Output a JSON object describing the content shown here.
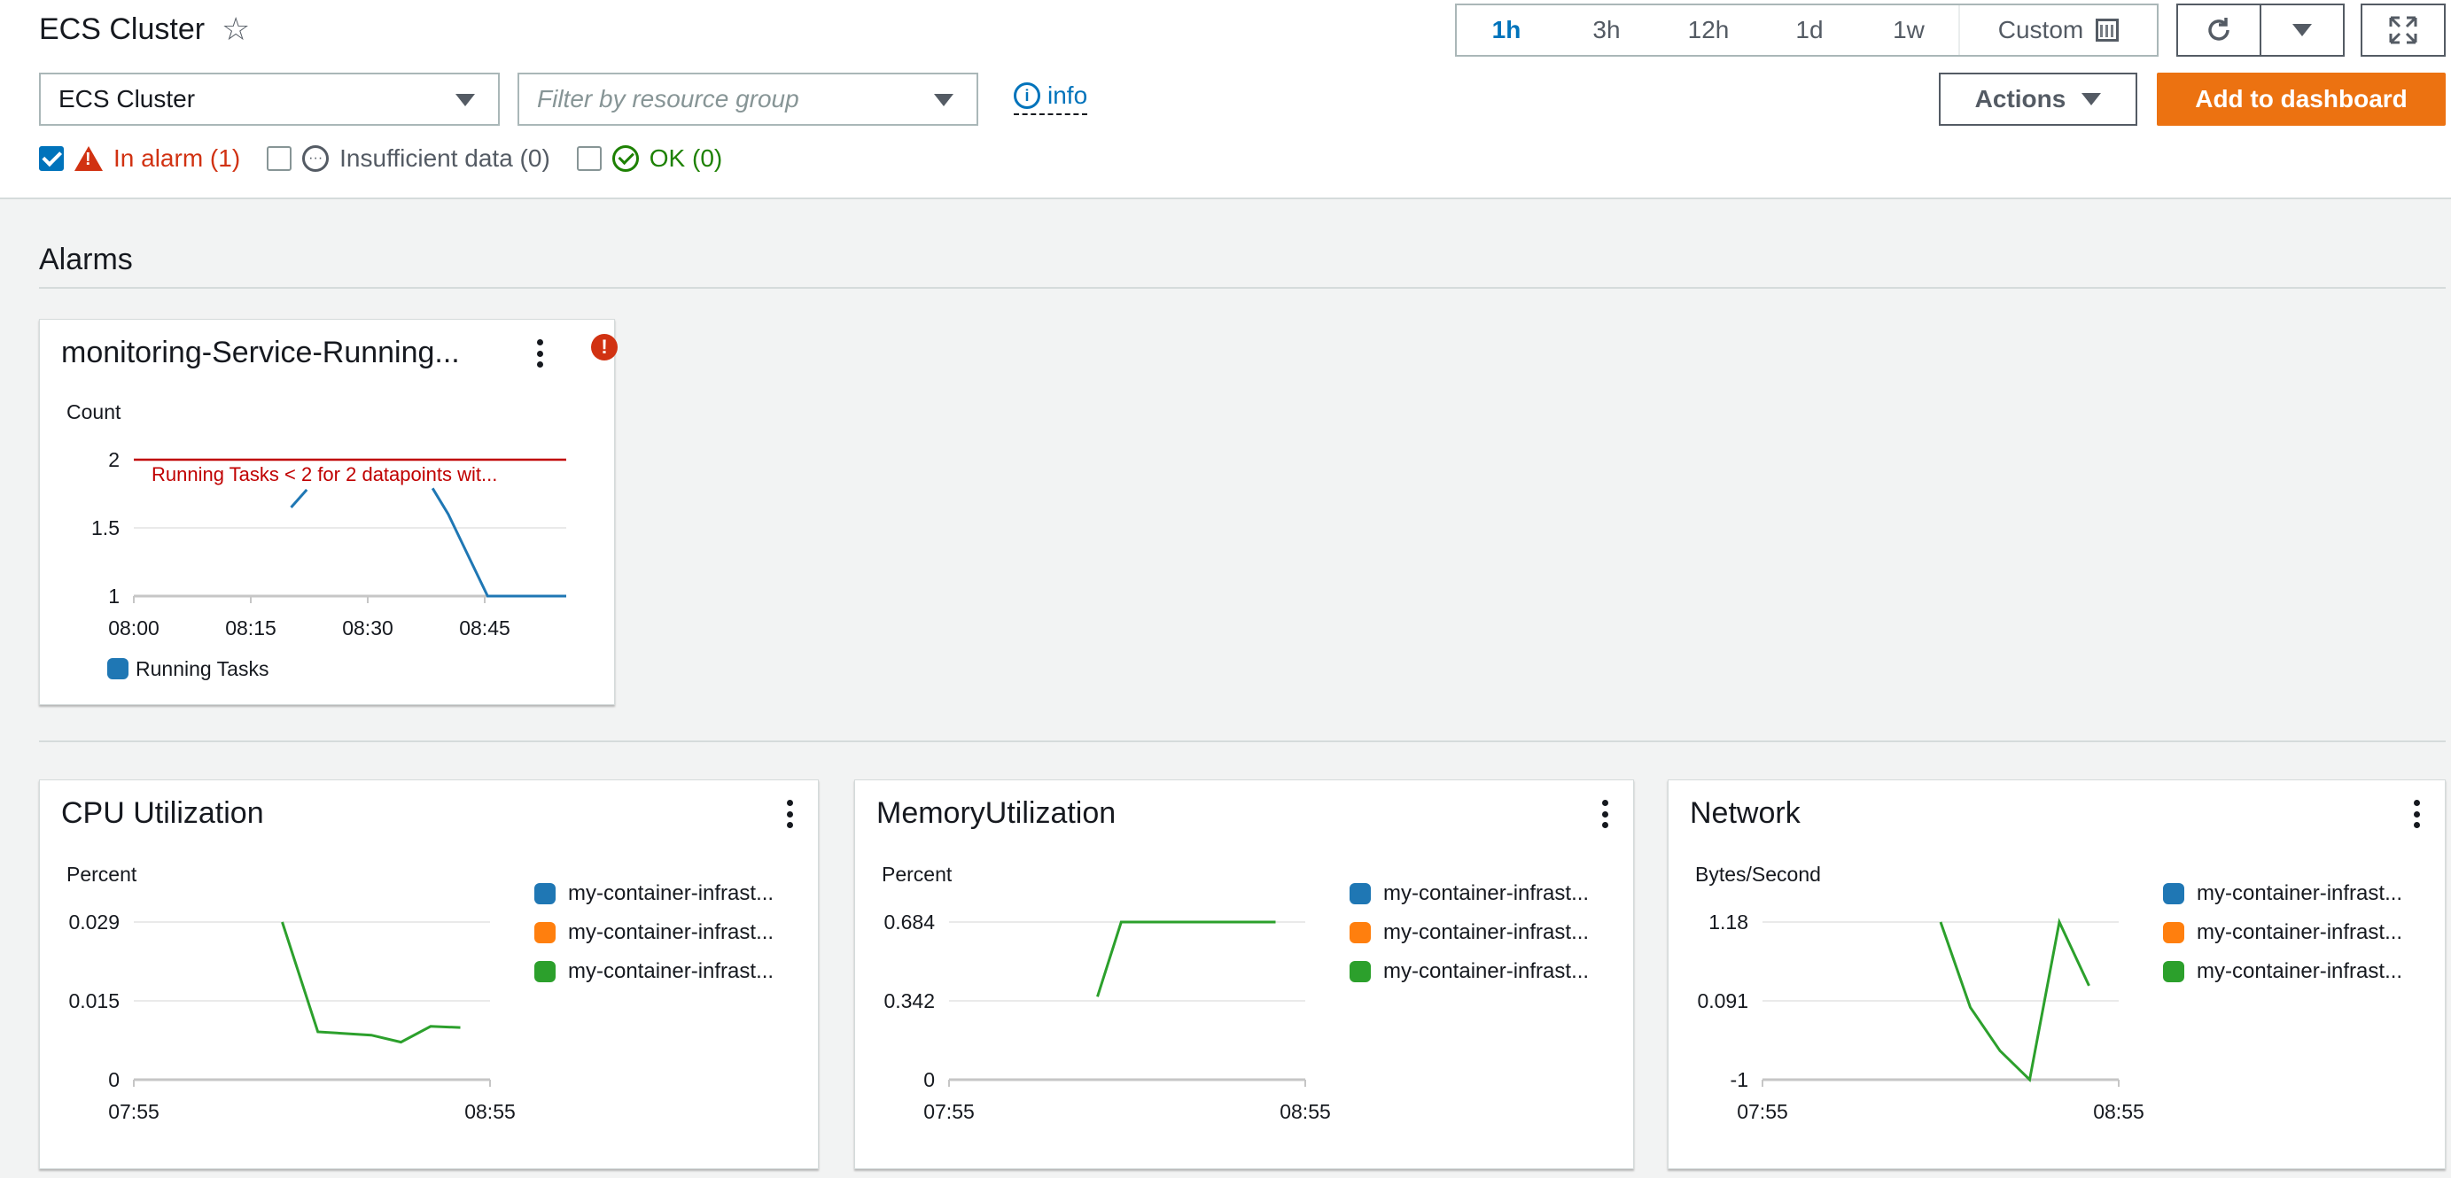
{
  "header": {
    "title": "ECS Cluster",
    "time_ranges": [
      "1h",
      "3h",
      "12h",
      "1d",
      "1w"
    ],
    "active_range": "1h",
    "custom_label": "Custom"
  },
  "toolbar": {
    "service_select": "ECS Cluster",
    "resource_filter_placeholder": "Filter by resource group",
    "info_label": "info",
    "actions_label": "Actions",
    "add_dashboard_label": "Add to dashboard"
  },
  "filters": {
    "in_alarm": "In alarm (1)",
    "insufficient": "Insufficient data (0)",
    "ok": "OK (0)"
  },
  "alarms_section": {
    "title": "Alarms"
  },
  "colors": {
    "blue": "#1f77b4",
    "orange": "#ff7f0e",
    "green": "#2ca02c",
    "alarm_red": "#d13212",
    "threshold_red": "#c00000",
    "primary_orange": "#ec7211"
  },
  "chart_data": [
    {
      "type": "line",
      "title": "monitoring-Service-Running...",
      "ylabel": "Count",
      "x_ticks": [
        "08:00",
        "08:15",
        "08:30",
        "08:45"
      ],
      "y_ticks": [
        "2",
        "1.5",
        "1"
      ],
      "ylim": [
        1,
        2
      ],
      "threshold": {
        "value": 2,
        "label": "Running Tasks < 2 for 2 datapoints wit..."
      },
      "series": [
        {
          "name": "Running Tasks",
          "color": "#1f77b4",
          "segments": [
            [
              [
                20,
                1.65
              ],
              [
                22,
                1.78
              ]
            ],
            [
              [
                38,
                1.79
              ],
              [
                40,
                1.6
              ],
              [
                45,
                1.0
              ],
              [
                55,
                1.0
              ]
            ]
          ]
        }
      ],
      "legend": [
        "Running Tasks"
      ]
    },
    {
      "type": "line",
      "title": "CPU Utilization",
      "ylabel": "Percent",
      "x_ticks": [
        "07:55",
        "08:55"
      ],
      "y_ticks": [
        "0.029",
        "0.015",
        "0"
      ],
      "ylim": [
        0,
        0.029
      ],
      "legend": [
        "my-container-infrast...",
        "my-container-infrast...",
        "my-container-infrast..."
      ],
      "series": [
        {
          "name": "my-container-infrast...",
          "color": "#2ca02c",
          "points": [
            [
              25,
              0.029
            ],
            [
              31,
              0.0088
            ],
            [
              40,
              0.0082
            ],
            [
              45,
              0.0069
            ],
            [
              50,
              0.0098
            ],
            [
              55,
              0.0096
            ]
          ]
        }
      ]
    },
    {
      "type": "line",
      "title": "MemoryUtilization",
      "ylabel": "Percent",
      "x_ticks": [
        "07:55",
        "08:55"
      ],
      "y_ticks": [
        "0.684",
        "0.342",
        "0"
      ],
      "ylim": [
        0,
        0.684
      ],
      "legend": [
        "my-container-infrast...",
        "my-container-infrast...",
        "my-container-infrast..."
      ],
      "series": [
        {
          "name": "my-container-infrast...",
          "color": "#2ca02c",
          "points": [
            [
              25,
              0.36
            ],
            [
              29,
              0.684
            ],
            [
              55,
              0.684
            ]
          ]
        }
      ]
    },
    {
      "type": "line",
      "title": "Network",
      "ylabel": "Bytes/Second",
      "x_ticks": [
        "07:55",
        "08:55"
      ],
      "y_ticks": [
        "1.18",
        "0.091",
        "-1"
      ],
      "ylim": [
        -1,
        1.18
      ],
      "legend": [
        "my-container-infrast...",
        "my-container-infrast...",
        "my-container-infrast..."
      ],
      "series": [
        {
          "name": "my-container-infrast...",
          "color": "#2ca02c",
          "points": [
            [
              30,
              1.18
            ],
            [
              35,
              0.0
            ],
            [
              40,
              -0.6
            ],
            [
              45,
              -1.0
            ],
            [
              50,
              1.18
            ],
            [
              55,
              0.3
            ]
          ]
        }
      ]
    }
  ]
}
